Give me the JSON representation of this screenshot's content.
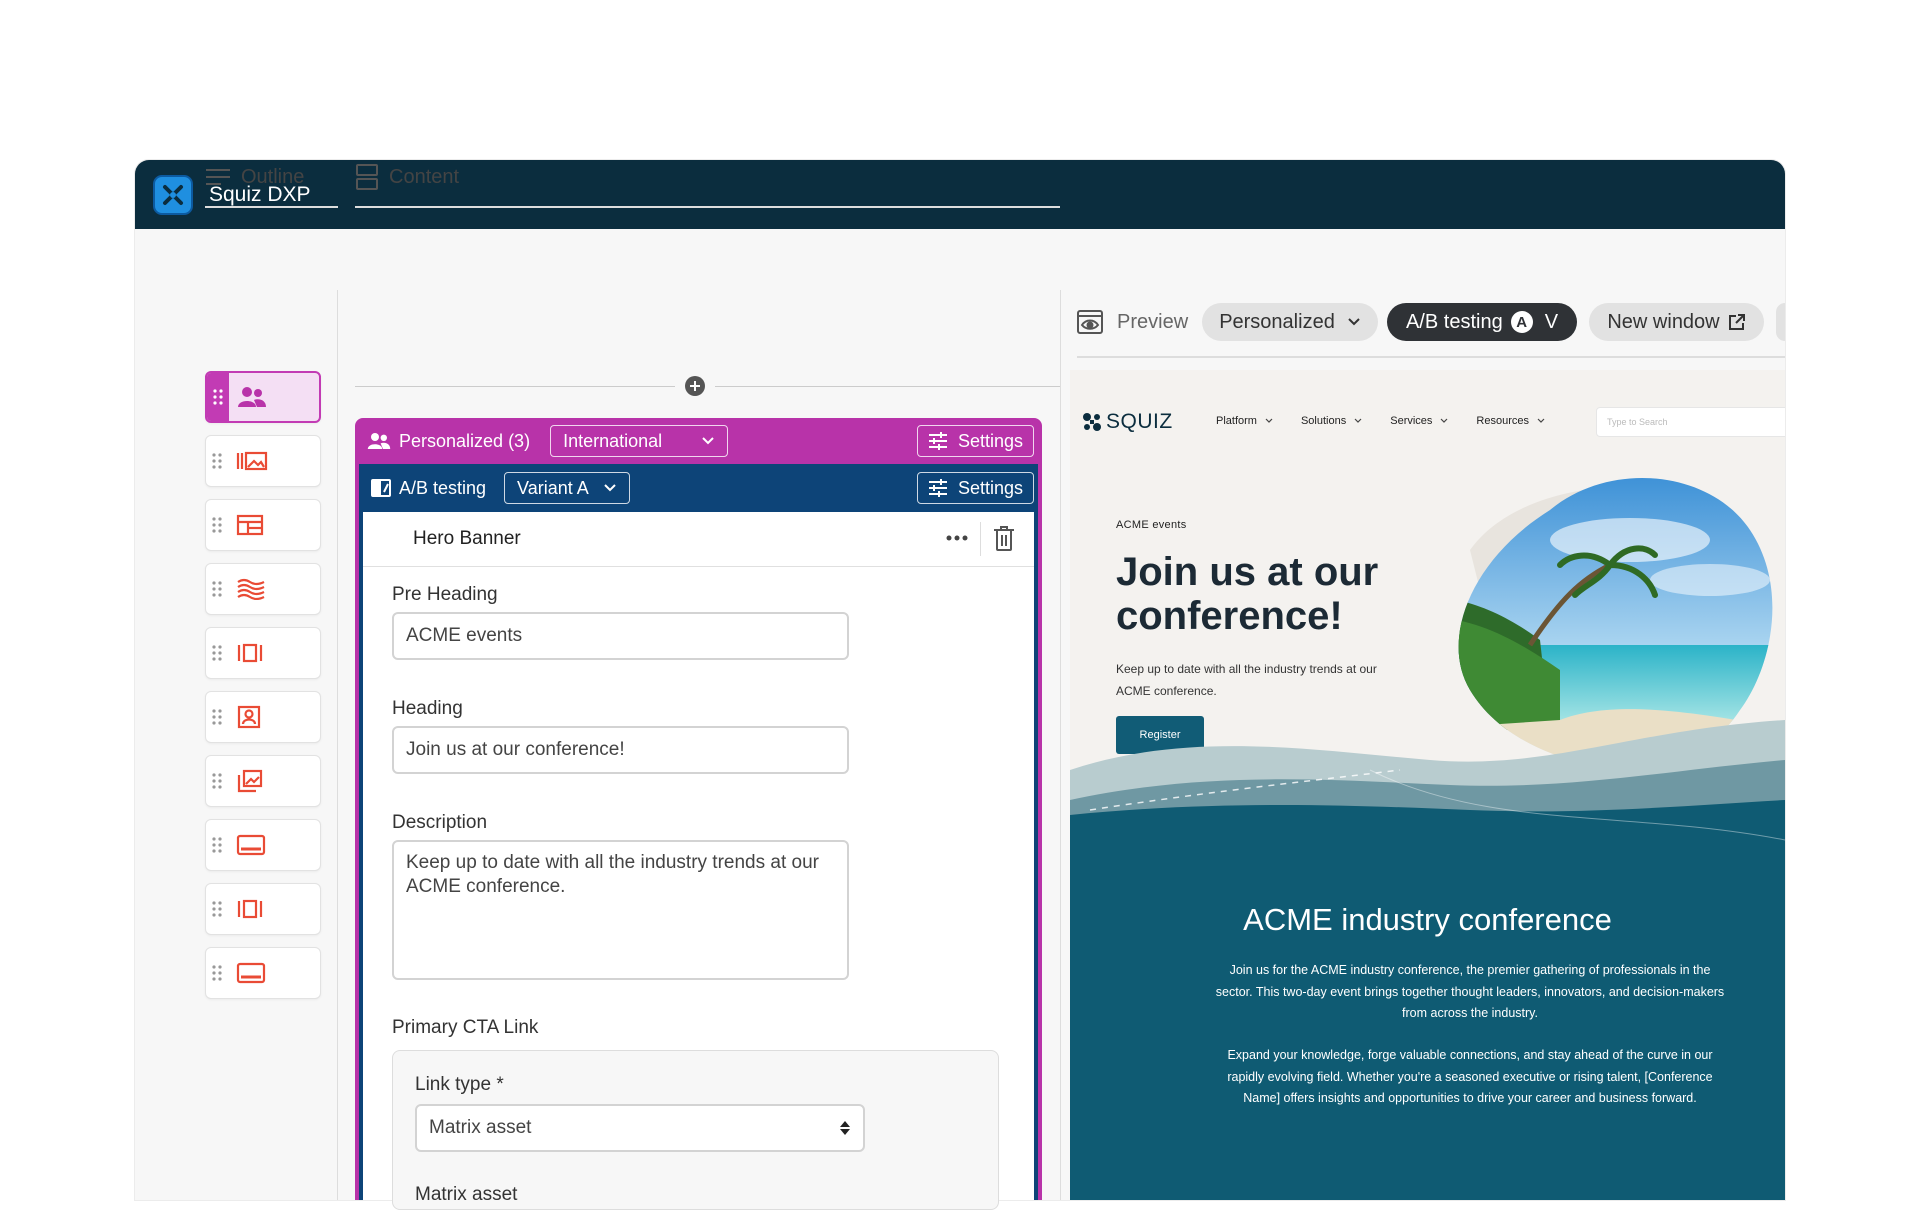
{
  "app": {
    "title": "Squiz DXP"
  },
  "outline": {
    "title": "Outline",
    "items": [
      {
        "icon": "personalization-people-icon"
      },
      {
        "icon": "image-carousel-icon"
      },
      {
        "icon": "layout-grid-icon"
      },
      {
        "icon": "wave-banner-icon"
      },
      {
        "icon": "columns-icon"
      },
      {
        "icon": "profile-card-icon"
      },
      {
        "icon": "image-gallery-icon"
      },
      {
        "icon": "banner-icon"
      },
      {
        "icon": "columns-icon"
      },
      {
        "icon": "banner-icon"
      }
    ]
  },
  "content": {
    "title": "Content",
    "personalized": {
      "label": "Personalized (3)",
      "segment": "International",
      "settings_label": "Settings",
      "color": "#b833a9"
    },
    "ab": {
      "label": "A/B testing",
      "variant": "Variant A",
      "settings_label": "Settings",
      "color": "#0d4478"
    },
    "component": {
      "title": "Hero Banner",
      "pre_heading_label": "Pre Heading",
      "pre_heading_value": "ACME events",
      "heading_label": "Heading",
      "heading_value": "Join us at our conference!",
      "description_label": "Description",
      "description_value": "Keep up to date with all the industry trends at our ACME conference.",
      "cta_label": "Primary CTA Link",
      "link_type_label": "Link type *",
      "link_type_value": "Matrix asset",
      "matrix_asset_label": "Matrix asset"
    }
  },
  "preview": {
    "title": "Preview",
    "personalized_label": "Personalized",
    "ab_label": "A/B testing",
    "ab_badge": "A",
    "ab_variant": "V",
    "new_window_label": "New window",
    "site": {
      "logo": "SQUIZ",
      "nav": [
        "Platform",
        "Solutions",
        "Services",
        "Resources"
      ],
      "search_placeholder": "Type to Search",
      "pre_heading": "ACME events",
      "heading": "Join us at our conference!",
      "description": "Keep up to date with all the industry trends at our ACME conference.",
      "register": "Register",
      "section_title": "ACME industry conference",
      "para1": "Join us for the ACME industry conference, the premier gathering of professionals in the sector. This two-day event brings together thought leaders, innovators, and decision-makers from across the industry.",
      "para2": "Expand your knowledge, forge valuable connections, and stay ahead of the curve in our rapidly evolving field. Whether you're a seasoned executive or rising talent, [Conference Name] offers insights and opportunities to drive your career and business forward."
    }
  },
  "colors": {
    "titlebar": "#0b2d3e",
    "accent_magenta": "#b833a9",
    "accent_navy": "#0d4478",
    "site_teal": "#0f5b73",
    "register_button": "#115c76"
  }
}
